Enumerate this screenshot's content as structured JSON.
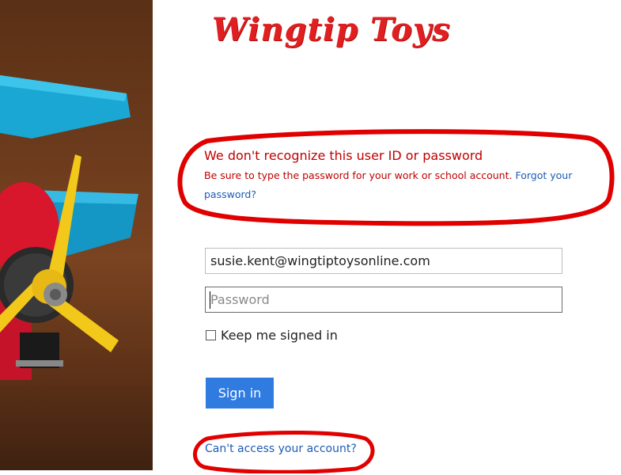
{
  "brand": {
    "logo_text": "Wingtip Toys",
    "logo_color": "#e02020"
  },
  "error": {
    "title": "We don't recognize this user ID or password",
    "detail": "Be sure to type the password for your work or school account.",
    "forgot_link": "Forgot your password?",
    "color": "#c00000"
  },
  "form": {
    "username_value": "susie.kent@wingtiptoysonline.com",
    "password_placeholder": "Password",
    "keep_signed_in_label": "Keep me signed in",
    "keep_signed_in_checked": false,
    "sign_in_label": "Sign in",
    "button_color": "#2f7be0"
  },
  "links": {
    "cant_access": "Can't access your account?",
    "link_color": "#1c5bb5"
  },
  "annotations": {
    "circle_color": "#e00000"
  },
  "image": {
    "subject": "toy-airplane-photo"
  }
}
